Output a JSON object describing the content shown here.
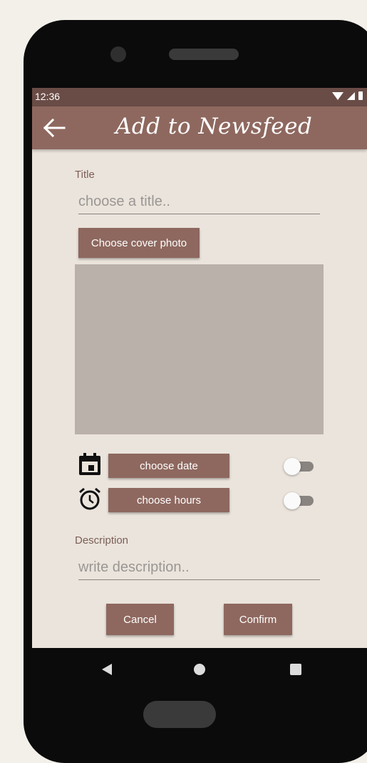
{
  "status_bar": {
    "time": "12:36"
  },
  "app_bar": {
    "title": "Add to Newsfeed",
    "back_icon": "arrow-left-icon"
  },
  "form": {
    "title_label": "Title",
    "title_placeholder": "choose a title..",
    "title_value": "",
    "cover_photo_button": "Choose cover photo",
    "date_button": "choose date",
    "date_toggle_on": false,
    "hours_button": "choose hours",
    "hours_toggle_on": false,
    "description_label": "Description",
    "description_placeholder": "write description..",
    "description_value": "",
    "cancel_button": "Cancel",
    "confirm_button": "Confirm"
  },
  "icons": {
    "date": "calendar-icon",
    "hours": "alarm-clock-icon"
  },
  "colors": {
    "accent": "#8e685f",
    "status_bar": "#6a4c46",
    "background": "#ebe4dc",
    "photo_placeholder": "#bab1aa"
  }
}
